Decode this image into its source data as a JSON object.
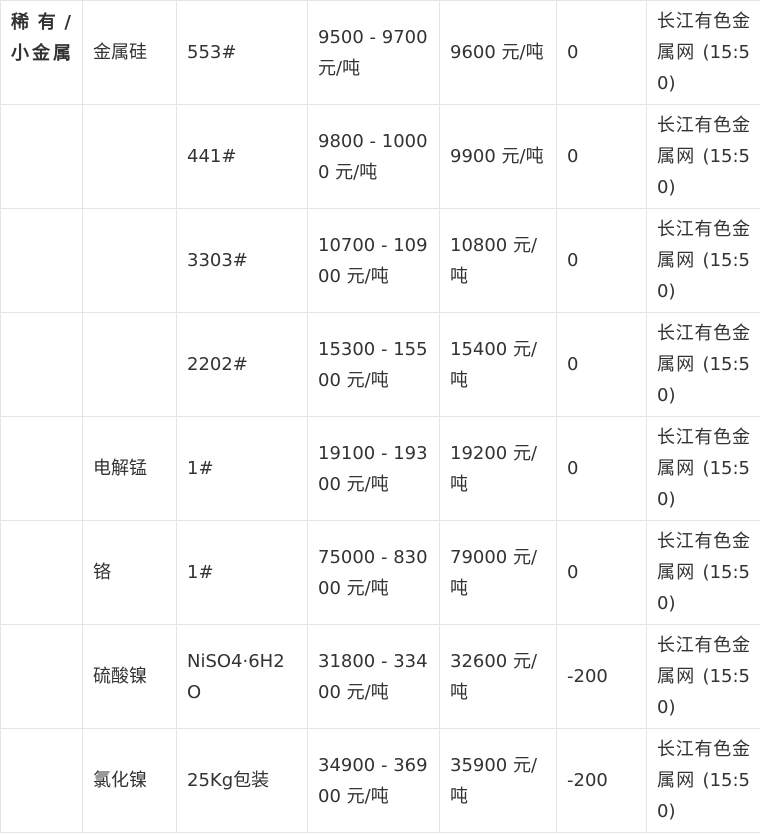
{
  "table": {
    "rows": [
      {
        "category": "稀有/小金属",
        "name": "金属硅",
        "spec": "553#",
        "range": "9500 - 9700 元/吨",
        "avg": "9600 元/吨",
        "change": "0",
        "source": "长江有色金属网 (15:50)"
      },
      {
        "category": "",
        "name": "",
        "spec": "441#",
        "range": "9800 - 10000 元/吨",
        "avg": "9900 元/吨",
        "change": "0",
        "source": "长江有色金属网 (15:50)"
      },
      {
        "category": "",
        "name": "",
        "spec": "3303#",
        "range": "10700 - 10900 元/吨",
        "avg": "10800 元/吨",
        "change": "0",
        "source": "长江有色金属网 (15:50)"
      },
      {
        "category": "",
        "name": "",
        "spec": "2202#",
        "range": "15300 - 15500 元/吨",
        "avg": "15400 元/吨",
        "change": "0",
        "source": "长江有色金属网 (15:50)"
      },
      {
        "category": "",
        "name": "电解锰",
        "spec": "1#",
        "range": "19100 - 19300 元/吨",
        "avg": "19200 元/吨",
        "change": "0",
        "source": "长江有色金属网 (15:50)"
      },
      {
        "category": "",
        "name": "铬",
        "spec": "1#",
        "range": "75000 - 83000 元/吨",
        "avg": "79000 元/吨",
        "change": "0",
        "source": "长江有色金属网 (15:50)"
      },
      {
        "category": "",
        "name": "硫酸镍",
        "spec": "NiSO4·6H2O",
        "range": "31800 - 33400 元/吨",
        "avg": "32600 元/吨",
        "change": "-200",
        "source": "长江有色金属网 (15:50)"
      },
      {
        "category": "",
        "name": "氯化镍",
        "spec": "25Kg包装",
        "range": "34900 - 36900 元/吨",
        "avg": "35900 元/吨",
        "change": "-200",
        "source": "长江有色金属网 (15:50)"
      }
    ]
  }
}
